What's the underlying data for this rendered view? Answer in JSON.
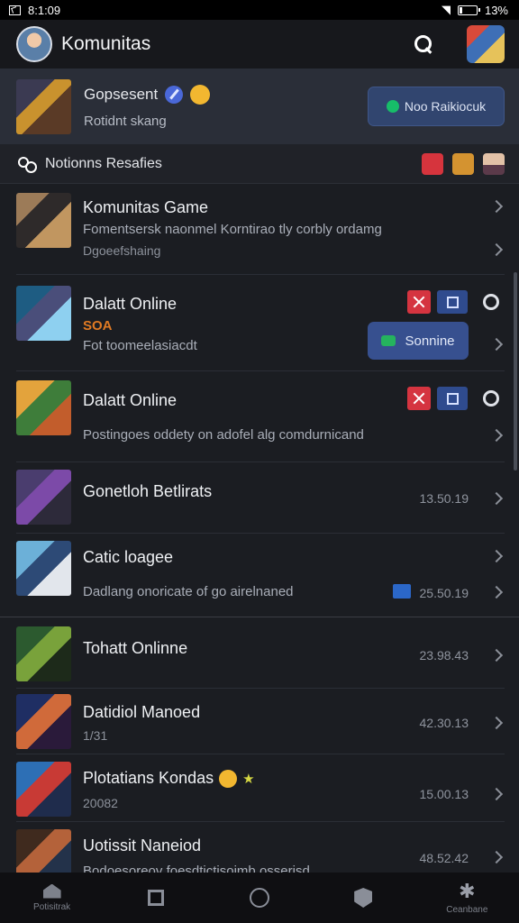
{
  "status_bar": {
    "time": "8:1:09",
    "battery": "13%",
    "battery_level": 0.13
  },
  "app_bar": {
    "title": "Komunitas"
  },
  "featured": {
    "title": "Gopsesent",
    "subtitle": "Rotidnt skang",
    "button_label": "Noo Raikiocuk"
  },
  "section": {
    "title": "Notionns Resafies"
  },
  "list": [
    {
      "title": "Komunitas Game",
      "subtitle": "Fomentsersk naonmel Korntirao tly corbly ordamg",
      "meta": "Dgoeefshaing"
    },
    {
      "title": "Dalatt Online",
      "tag": "SOA",
      "subtitle": "Fot toomeelasiacdt",
      "button_label": "Sonnine"
    },
    {
      "title": "Dalatt Online",
      "subtitle": "Postingoes oddety on adofel alg comdurnicand"
    },
    {
      "title": "Gonetloh Betlirats",
      "number": "13.50.19"
    },
    {
      "title": "Catic loagee",
      "subtitle": "Dadlang onoricate of go airelnaned",
      "number": "25.50.19"
    },
    {
      "title": "Tohatt Onlinne",
      "number": "23.98.43"
    },
    {
      "title": "Datidiol Manoed",
      "meta": "1/31",
      "number": "42.30.13"
    },
    {
      "title": "Plotatians Kondas",
      "meta": "20082",
      "number": "15.00.13"
    },
    {
      "title": "Uotissit Naneiod",
      "subtitle": "Bodoesoreov foesdtictisoimb osserisd",
      "number": "48.52.42"
    }
  ],
  "bottom_nav": [
    {
      "label": "Potisitrak",
      "icon": "home-icon"
    },
    {
      "label": "",
      "icon": "square-icon"
    },
    {
      "label": "",
      "icon": "circle-icon"
    },
    {
      "label": "",
      "icon": "shield-icon"
    },
    {
      "label": "Ceanbane",
      "icon": "spark-icon"
    }
  ]
}
